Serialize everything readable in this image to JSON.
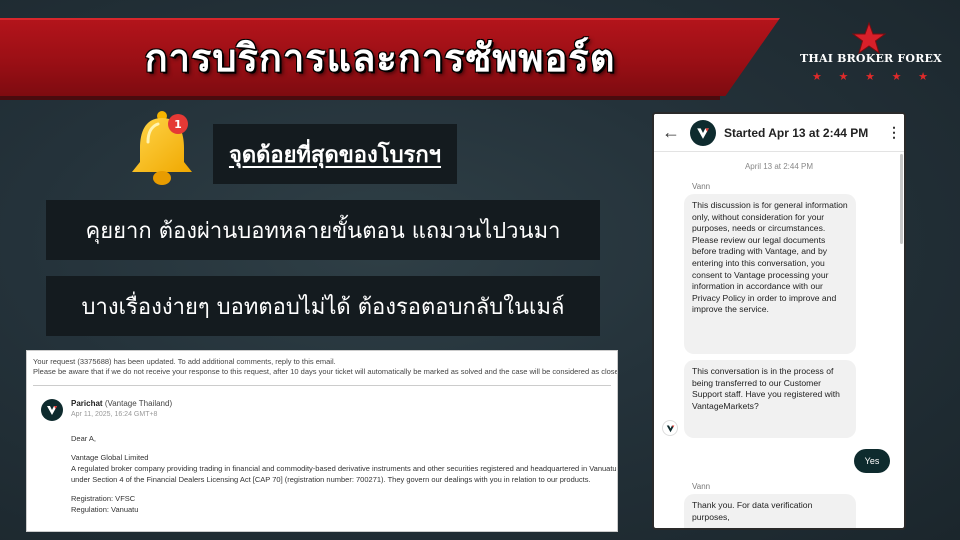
{
  "header": {
    "title": "การบริการและการซัพพอร์ต"
  },
  "logo": {
    "text": "THAI BROKER FOREX",
    "stars": [
      "★",
      "★",
      "★",
      "★",
      "★"
    ],
    "accent_color": "#e02a2a"
  },
  "bell": {
    "badge_count": "1"
  },
  "weakness": {
    "heading": "จุดด้อยที่สุดของโบรกฯ",
    "points": [
      "คุยยาก ต้องผ่านบอทหลายขั้นตอน แถมวนไปวนมา",
      "บางเรื่องง่ายๆ บอทตอบไม่ได้ ต้องรอตอบกลับในเมล์"
    ]
  },
  "email": {
    "notice_line1": "Your request (3375688) has been updated. To add additional comments, reply to this email.",
    "notice_line2": "Please be aware that if we do not receive your response to this request, after 10 days your ticket will automatically be marked as solved and the case will be considered as closed.",
    "sender_name": "Parichat",
    "sender_org": "(Vantage Thailand)",
    "sender_date": "Apr 11, 2025, 16:24 GMT+8",
    "greeting": "Dear A,",
    "company": "Vantage Global Limited",
    "description_line1": "A regulated broker company providing trading in financial and commodity-based derivative instruments and other securities registered and headquartered in Vanuatu since",
    "description_line2": "under Section 4 of the Financial Dealers Licensing Act [CAP 70] (registration number: 700271). They govern our dealings with you in relation to our products.",
    "registration": "Registration: VFSC",
    "regulation": "Regulation: Vanuatu"
  },
  "chat": {
    "title": "Started Apr 13 at 2:44 PM",
    "date_label": "April 13 at 2:44 PM",
    "sender_name": "Vann",
    "message1": "This discussion is for general information only, without consideration for your purposes, needs or circumstances. Please review our legal documents before trading with Vantage, and by entering into this conversation, you consent to Vantage processing your information in accordance with our Privacy Policy in order to improve and improve the service.",
    "message2": "This conversation is in the process of being transferred to our Customer Support staff. Have you registered with VantageMarkets?",
    "user_reply": "Yes",
    "sender_name2": "Vann",
    "message3": "Thank you. For data verification purposes,",
    "brand_color": "#0e2b2e"
  }
}
